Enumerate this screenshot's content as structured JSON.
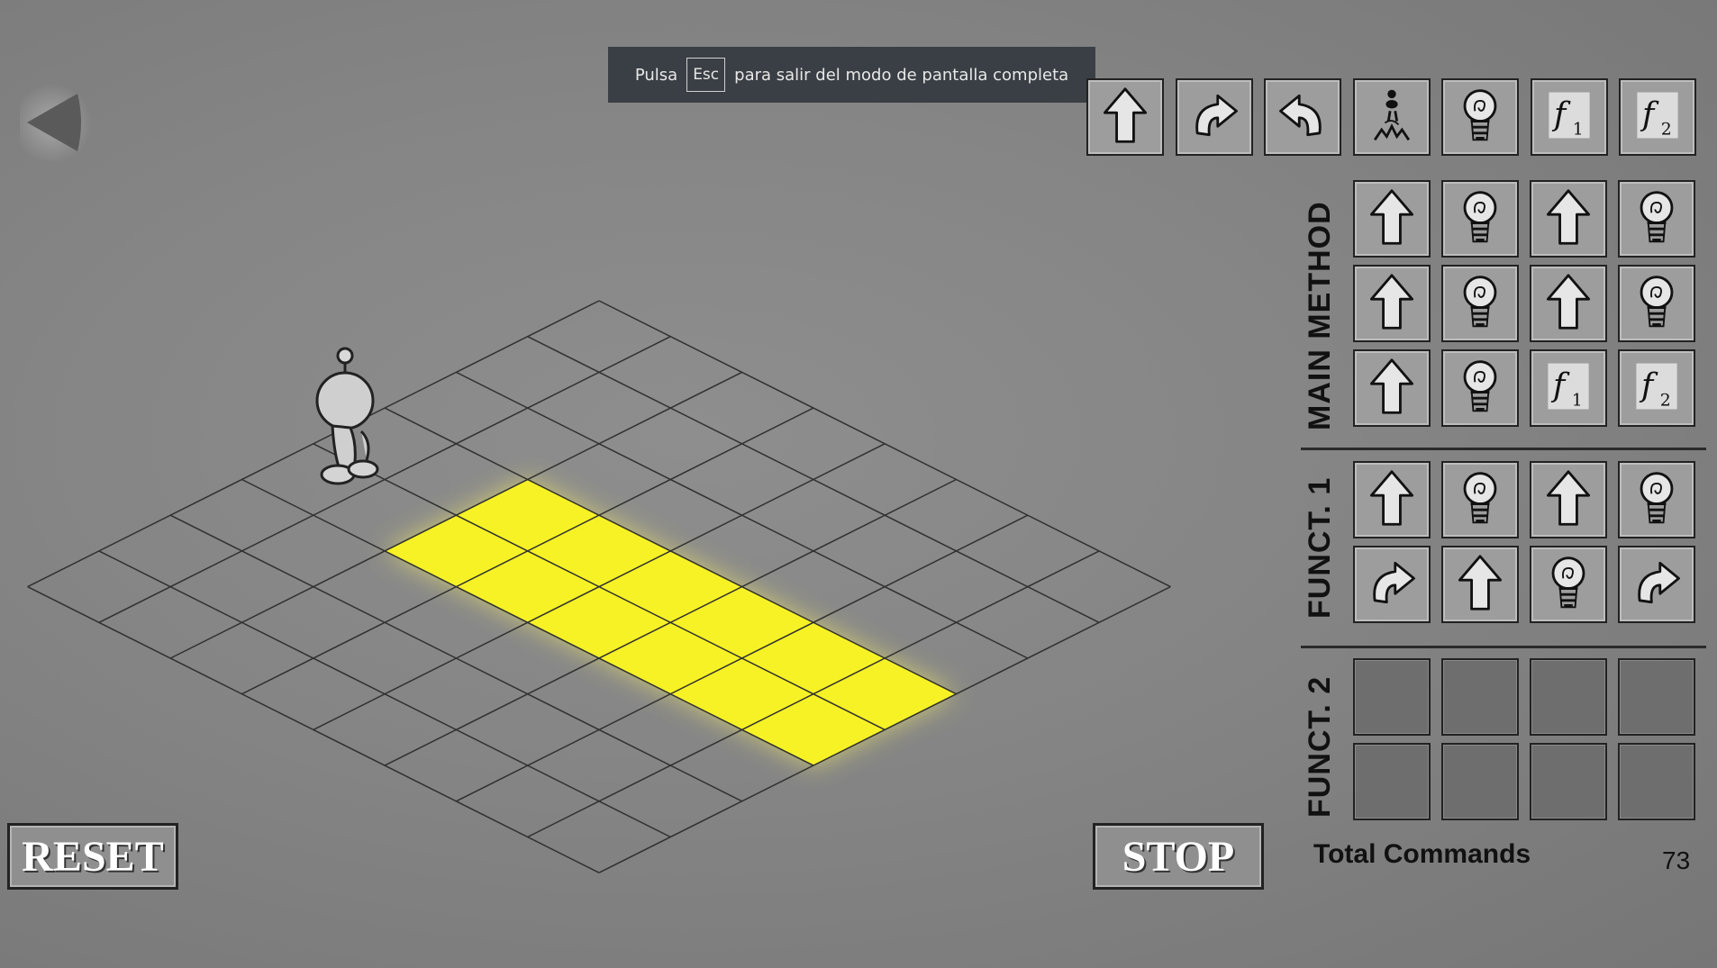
{
  "toast": {
    "prefix": "Pulsa",
    "key": "Esc",
    "suffix": "para salir del modo de pantalla completa"
  },
  "palette": [
    "forward",
    "turn-right",
    "turn-left",
    "jump",
    "light",
    "f1",
    "f2"
  ],
  "main_method": {
    "label": "MAIN METHOD",
    "commands": [
      "forward",
      "light",
      "forward",
      "light",
      "forward",
      "light",
      "forward",
      "light",
      "forward",
      "light",
      "f1",
      "f2"
    ]
  },
  "funct1": {
    "label": "FUNCT. 1",
    "commands": [
      "forward",
      "light",
      "forward",
      "light",
      "turn-right",
      "forward",
      "light",
      "turn-right"
    ]
  },
  "funct2": {
    "label": "FUNCT. 2",
    "commands": [
      "",
      "",
      "",
      "",
      "",
      "",
      "",
      ""
    ]
  },
  "buttons": {
    "reset": "RESET",
    "stop": "STOP"
  },
  "total": {
    "label": "Total Commands",
    "value": "73"
  },
  "colors": {
    "lit_tile": "#f7f225",
    "grid_line": "#303030"
  }
}
